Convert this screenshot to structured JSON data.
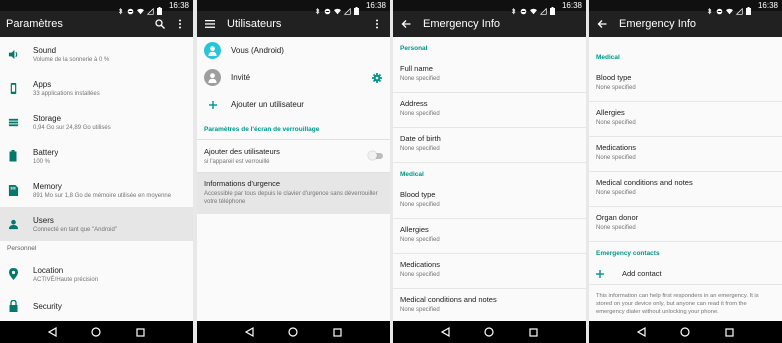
{
  "status": {
    "time": "16:38"
  },
  "settings": {
    "title": "Paramètres",
    "items": [
      {
        "title": "Sound",
        "sub": "Volume de la sonnerie à 0 %"
      },
      {
        "title": "Apps",
        "sub": "33 applications installées"
      },
      {
        "title": "Storage",
        "sub": "0,94 Go sur 24,89 Go utilisés"
      },
      {
        "title": "Battery",
        "sub": "100 %"
      },
      {
        "title": "Memory",
        "sub": "891 Mo sur 1,8 Go de mémoire utilisée en moyenne"
      },
      {
        "title": "Users",
        "sub": "Connecté en tant que \"Android\""
      }
    ],
    "category": "Personnel",
    "items2": [
      {
        "title": "Location",
        "sub": "ACTIVÉ/Haute précision"
      },
      {
        "title": "Security",
        "sub": ""
      }
    ]
  },
  "users": {
    "title": "Utilisateurs",
    "you": "Vous (Android)",
    "guest": "Invité",
    "add_user": "Ajouter un utilisateur",
    "lock_header": "Paramètres de l'écran de verrouillage",
    "add_users_title": "Ajouter des utilisateurs",
    "add_users_sub": "si l'appareil est verrouillé",
    "info_title": "Informations d'urgence",
    "info_sub": "Accessible par tous depuis le clavier d'urgence sans déverrouiller votre téléphone"
  },
  "emergency1": {
    "title": "Emergency Info",
    "personal_header": "Personal",
    "personal": [
      {
        "label": "Full name",
        "value": "None specified"
      },
      {
        "label": "Address",
        "value": "None specified"
      },
      {
        "label": "Date of birth",
        "value": "None specified"
      }
    ],
    "medical_header": "Medical",
    "medical": [
      {
        "label": "Blood type",
        "value": "None specified"
      },
      {
        "label": "Allergies",
        "value": "None specified"
      },
      {
        "label": "Medications",
        "value": "None specified"
      },
      {
        "label": "Medical conditions and notes",
        "value": "None specified"
      }
    ]
  },
  "emergency2": {
    "title": "Emergency Info",
    "medical_header": "Medical",
    "medical": [
      {
        "label": "Blood type",
        "value": "None specified"
      },
      {
        "label": "Allergies",
        "value": "None specified"
      },
      {
        "label": "Medications",
        "value": "None specified"
      },
      {
        "label": "Medical conditions and notes",
        "value": "None specified"
      },
      {
        "label": "Organ donor",
        "value": "None specified"
      }
    ],
    "contacts_header": "Emergency contacts",
    "add_contact": "Add contact",
    "footer": "This information can help first responders in an emergency. It is stored on your device only, but anyone can read it from the emergency dialer without unlocking your phone."
  },
  "colors": {
    "accent": "#009688",
    "appbar": "#212121",
    "statusbar": "#101010",
    "navbar": "#000000",
    "icon": "#00796b"
  },
  "icons": [
    "search-icon",
    "more-vert-icon",
    "menu-icon",
    "back-arrow-icon",
    "gear-icon",
    "add-icon",
    "volume-icon",
    "apps-icon",
    "storage-icon",
    "battery-icon",
    "memory-icon",
    "user-icon",
    "location-icon",
    "lock-icon",
    "nav-back-icon",
    "nav-home-icon",
    "nav-recents-icon"
  ]
}
